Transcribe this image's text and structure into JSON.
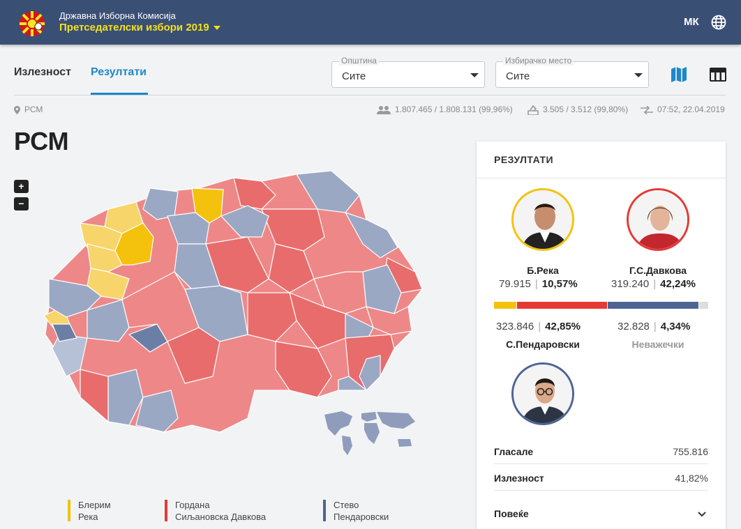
{
  "header": {
    "org": "Државна Изборна Комисија",
    "election": "Претседателски избори 2019",
    "lang": "МК",
    "logo_icon": "sun-flag-logo",
    "globe_icon": "globe-icon"
  },
  "tabs": [
    {
      "label": "Излезност",
      "active": false
    },
    {
      "label": "Резултати",
      "active": true
    }
  ],
  "filters": {
    "municipality": {
      "legend": "Општина",
      "value": "Сите"
    },
    "station": {
      "legend": "Избирачко место",
      "value": "Сите"
    }
  },
  "info": {
    "location": "РСМ",
    "voters": "1.807.465 / 1.808.131 (99,96%)",
    "stations": "3.505 / 3.512 (99,80%)",
    "updated": "07:52, 22.04.2019"
  },
  "page_title": "РСМ",
  "zoom": {
    "in": "+",
    "out": "−"
  },
  "legend": [
    {
      "line1": "Блерим",
      "line2": "Река",
      "color": "#f4c20d"
    },
    {
      "line1": "Гордана",
      "line2": "Сиљановска Давкова",
      "color": "#e53935"
    },
    {
      "line1": "Стево",
      "line2": "Пендаровски",
      "color": "#4e6593"
    }
  ],
  "results": {
    "title": "РЕЗУЛТАТИ",
    "candidates": [
      {
        "name": "Б.Река",
        "votes": "79.915",
        "percent": "10,57%",
        "share": 10.57,
        "color": "#f4c20d"
      },
      {
        "name": "Г.С.Давкова",
        "votes": "319.240",
        "percent": "42,24%",
        "share": 42.24,
        "color": "#e53935"
      },
      {
        "name": "С.Пендаровски",
        "votes": "323.846",
        "percent": "42,85%",
        "share": 42.85,
        "color": "#4e6593"
      },
      {
        "name": "Неважечки",
        "votes": "32.828",
        "percent": "4,34%",
        "share": 4.34,
        "color": "#dddddd"
      }
    ],
    "voted_label": "Гласале",
    "voted_value": "755.816",
    "turnout_label": "Излезност",
    "turnout_value": "41,82%",
    "more_label": "Повеќе"
  }
}
